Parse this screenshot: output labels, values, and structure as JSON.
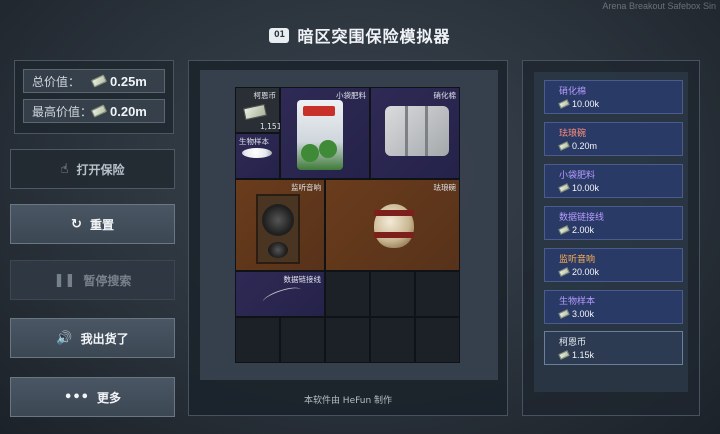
{
  "watermark": "Arena Breakout Safebox Sin",
  "header": {
    "icon_text": "O1",
    "title": "暗区突围保险模拟器"
  },
  "stats": [
    {
      "label": "总价值：",
      "value": "0.25m"
    },
    {
      "label": "最高价值：",
      "value": "0.20m"
    }
  ],
  "buttons": {
    "open": {
      "icon": "☝",
      "label": "打开保险"
    },
    "reset": {
      "icon": "↻",
      "label": "重置"
    },
    "pause": {
      "icon": "❚❚",
      "label": "暂停搜索"
    },
    "sold": {
      "icon": "🔊",
      "label": "我出货了"
    },
    "more": {
      "icon": "•••",
      "label": "更多"
    }
  },
  "grid_items": {
    "cash": {
      "name": "柯恩币",
      "count": "1,151"
    },
    "fertilizer": {
      "name": "小袋肥料"
    },
    "cotton": {
      "name": "硝化棉"
    },
    "sample": {
      "name": "生物样本"
    },
    "speaker": {
      "name": "监听音响"
    },
    "vase": {
      "name": "珐琅碗"
    },
    "cable": {
      "name": "数据链接线"
    }
  },
  "credit": "本软件由 HeFun 制作",
  "loot_list": [
    {
      "name": "硝化棉",
      "value": "10.00k",
      "name_color": "#b59cff",
      "style": "rarity"
    },
    {
      "name": "珐琅碗",
      "value": "0.20m",
      "name_color": "#ff8f7a",
      "style": "rarity"
    },
    {
      "name": "小袋肥料",
      "value": "10.00k",
      "name_color": "#b59cff",
      "style": "rarity"
    },
    {
      "name": "数据链接线",
      "value": "2.00k",
      "name_color": "#b59cff",
      "style": "rarity"
    },
    {
      "name": "监听音响",
      "value": "20.00k",
      "name_color": "#ffb050",
      "style": "rarity"
    },
    {
      "name": "生物样本",
      "value": "3.00k",
      "name_color": "#b59cff",
      "style": "rarity"
    },
    {
      "name": "柯恩币",
      "value": "1.15k",
      "name_color": "#e8edf3",
      "style": "plain"
    }
  ]
}
